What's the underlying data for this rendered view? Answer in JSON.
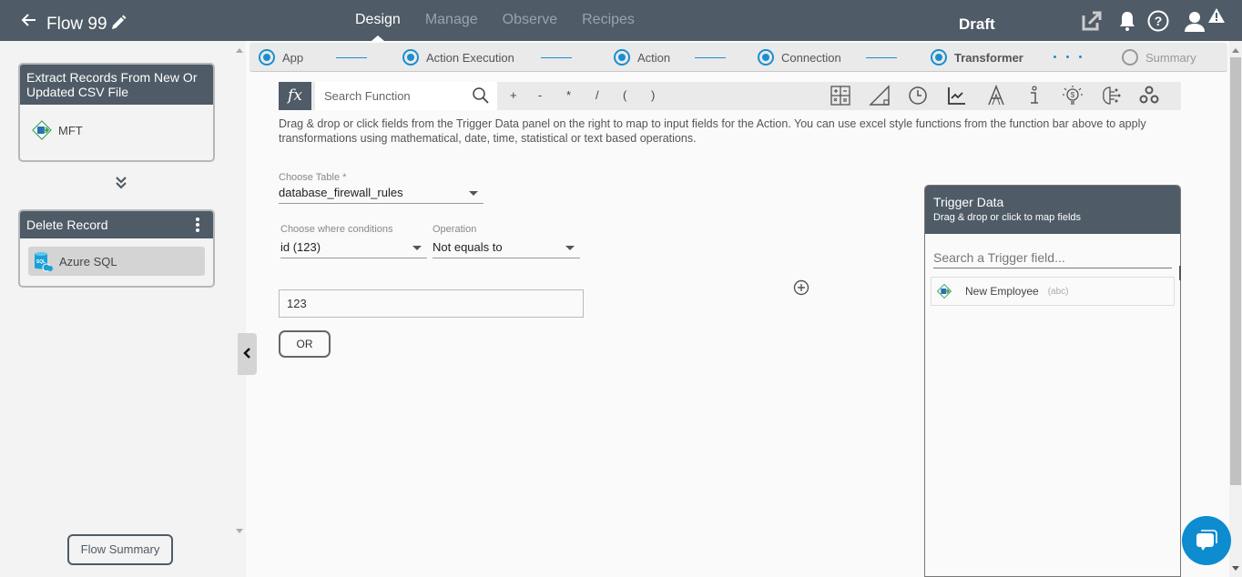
{
  "header": {
    "back_icon": "arrow-left-icon",
    "flow_title": "Flow 99",
    "edit_icon": "pencil-icon",
    "nav_tabs": [
      {
        "label": "Design",
        "active": true
      },
      {
        "label": "Manage",
        "active": false
      },
      {
        "label": "Observe",
        "active": false
      },
      {
        "label": "Recipes",
        "active": false
      }
    ],
    "status": "Draft",
    "icons": [
      "external-link-icon",
      "bell-icon",
      "help-icon",
      "user-icon",
      "warning-icon"
    ]
  },
  "sidebar": {
    "trigger_card": {
      "title": "Extract Records From New Or Updated CSV File",
      "app_name": "MFT",
      "app_icon": "mft-icon"
    },
    "connector_icon": "double-chevron-down-icon",
    "action_card": {
      "title": "Delete Record",
      "menu_icon": "kebab-menu-icon",
      "app_name": "Azure SQL",
      "app_icon": "azure-sql-icon"
    },
    "flow_summary_label": "Flow Summary",
    "collapse_icon": "chevron-left-icon"
  },
  "steps": [
    {
      "label": "App",
      "state": "done"
    },
    {
      "label": "Action Execution",
      "state": "done"
    },
    {
      "label": "Action",
      "state": "done"
    },
    {
      "label": "Connection",
      "state": "done"
    },
    {
      "label": "Transformer",
      "state": "current"
    },
    {
      "label": "Summary",
      "state": "pending"
    }
  ],
  "function_bar": {
    "fx_label": "fx",
    "search_placeholder": "Search Function",
    "operators": [
      "+",
      "-",
      "*",
      "/",
      "(",
      ")"
    ],
    "category_icons": [
      "math-operators-icon",
      "trigonometry-icon",
      "clock-icon",
      "chart-line-icon",
      "text-icon",
      "info-icon",
      "finance-icon",
      "ai-brain-icon",
      "gears-icon"
    ]
  },
  "help_text": "Drag & drop or click fields from the Trigger Data panel on the right to map to input fields for the Action. You can use excel style functions from the function bar above to apply transformations using mathematical, date, time, statistical or text based operations.",
  "form": {
    "table_label": "Choose Table *",
    "table_value": "database_firewall_rules",
    "where_label": "Choose where conditions",
    "where_value": "id (123)",
    "operation_label": "Operation",
    "operation_value": "Not equals to",
    "condition_value": "123",
    "or_button": "OR",
    "add_condition_icon": "plus-circle-icon"
  },
  "trigger_panel": {
    "title": "Trigger Data",
    "subtitle": "Drag & drop or click to map fields",
    "search_placeholder": "Search a Trigger field...",
    "fields": [
      {
        "name": "New Employee",
        "type": "(abc)",
        "icon": "mft-icon"
      }
    ]
  },
  "chat_icon": "chat-bubble-icon",
  "colors": {
    "header_bg": "#4f5b66",
    "accent": "#1a8fcf",
    "chat": "#0d8ccf"
  }
}
